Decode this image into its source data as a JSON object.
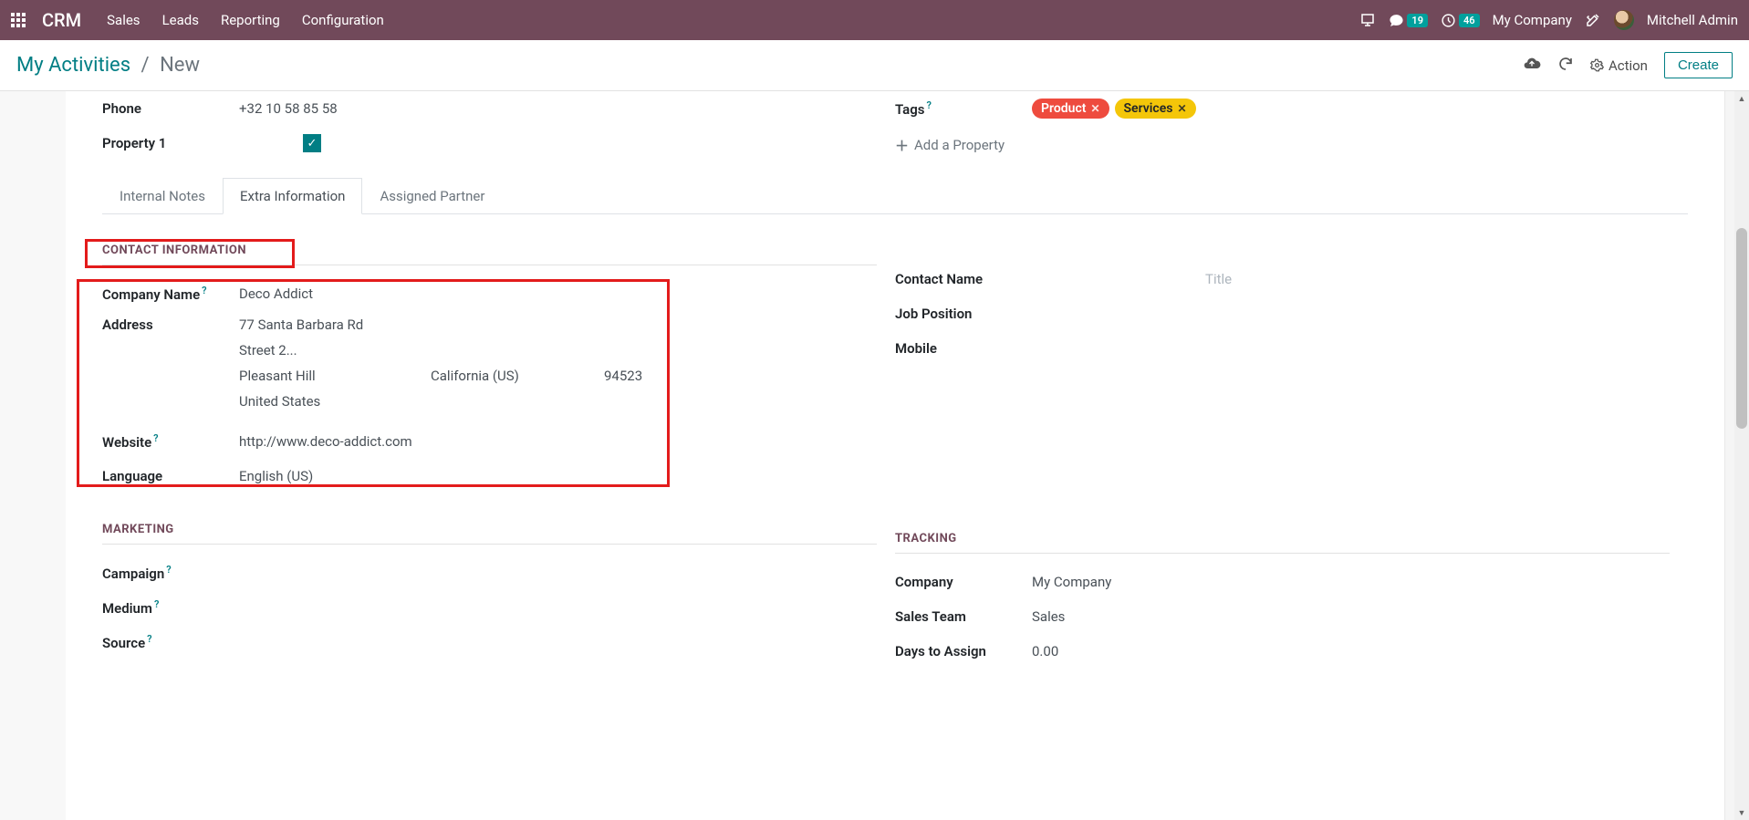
{
  "topbar": {
    "app_name": "CRM",
    "menu": [
      "Sales",
      "Leads",
      "Reporting",
      "Configuration"
    ],
    "messages_badge": "19",
    "activities_badge": "46",
    "company": "My Company",
    "user": "Mitchell Admin"
  },
  "control": {
    "breadcrumb_root": "My Activities",
    "breadcrumb_leaf": "New",
    "action_label": "Action",
    "create_label": "Create"
  },
  "header_fields": {
    "phone_label": "Phone",
    "phone_value": "+32 10 58 85 58",
    "property1_label": "Property 1",
    "tags_label": "Tags",
    "tag_product": "Product",
    "tag_services": "Services",
    "add_property": "Add a Property"
  },
  "tabs": {
    "internal_notes": "Internal Notes",
    "extra_info": "Extra Information",
    "assigned_partner": "Assigned Partner"
  },
  "contact": {
    "section": "CONTACT INFORMATION",
    "company_name_label": "Company Name",
    "company_name_value": "Deco Addict",
    "address_label": "Address",
    "street1": "77 Santa Barbara Rd",
    "street2_placeholder": "Street 2...",
    "city": "Pleasant Hill",
    "state": "California (US)",
    "zip": "94523",
    "country": "United States",
    "website_label": "Website",
    "website_value": "http://www.deco-addict.com",
    "language_label": "Language",
    "language_value": "English (US)",
    "contact_name_label": "Contact Name",
    "title_placeholder": "Title",
    "job_position_label": "Job Position",
    "mobile_label": "Mobile"
  },
  "marketing": {
    "section": "MARKETING",
    "campaign_label": "Campaign",
    "medium_label": "Medium",
    "source_label": "Source"
  },
  "tracking": {
    "section": "TRACKING",
    "company_label": "Company",
    "company_value": "My Company",
    "sales_team_label": "Sales Team",
    "sales_team_value": "Sales",
    "days_to_assign_label": "Days to Assign",
    "days_to_assign_value": "0.00"
  }
}
